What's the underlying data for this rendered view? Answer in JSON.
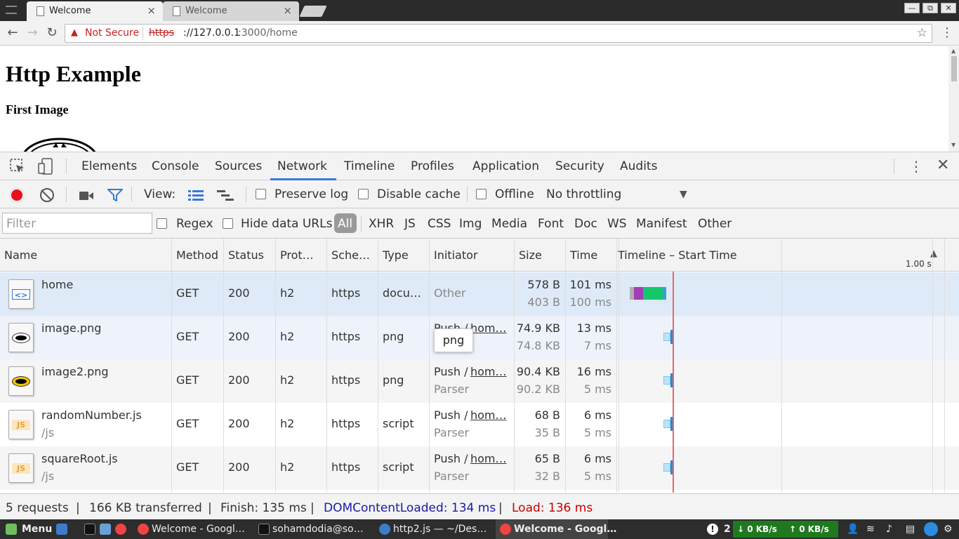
{
  "browser": {
    "tabs": [
      {
        "label": "Welcome",
        "active": true
      },
      {
        "label": "Welcome",
        "active": false
      }
    ],
    "tab_close": "×",
    "window_buttons": [
      "—",
      "⧉",
      "✕"
    ],
    "omnibox": {
      "security_label": "Not Secure",
      "scheme": "https",
      "host": "://127.0.0.1",
      "path": ":3000/home"
    }
  },
  "page": {
    "heading": "Http Example",
    "subheading": "First Image"
  },
  "devtools": {
    "tabs": [
      "Elements",
      "Console",
      "Sources",
      "Network",
      "Timeline",
      "Profiles",
      "Application",
      "Security",
      "Audits"
    ],
    "active_tab": "Network",
    "controls": {
      "view_label": "View:",
      "preserve_log": "Preserve log",
      "disable_cache": "Disable cache",
      "offline": "Offline",
      "throttling": "No throttling"
    },
    "filters": {
      "placeholder": "Filter",
      "regex": "Regex",
      "hide_data_urls": "Hide data URLs",
      "types": [
        "All",
        "XHR",
        "JS",
        "CSS",
        "Img",
        "Media",
        "Font",
        "Doc",
        "WS",
        "Manifest",
        "Other"
      ],
      "active_type": "All"
    },
    "columns": [
      "Name",
      "Method",
      "Status",
      "Prot…",
      "Sche…",
      "Type",
      "Initiator",
      "Size",
      "Time",
      "Timeline – Start Time"
    ],
    "timeline_scale": "1.00 s",
    "rows": [
      {
        "name": "home",
        "path": "",
        "method": "GET",
        "status": "200",
        "protocol": "h2",
        "scheme": "https",
        "type": "docu…",
        "initiator": "Other",
        "initiator_link": "",
        "initiator_sub": "",
        "size": "578 B",
        "size_sub": "403 B",
        "time": "101 ms",
        "time_sub": "100 ms",
        "icon": "document-icon",
        "bg": "#dfeaf8"
      },
      {
        "name": "image.png",
        "path": "",
        "method": "GET",
        "status": "200",
        "protocol": "h2",
        "scheme": "https",
        "type": "png",
        "initiator": "Push / ",
        "initiator_link": "hom…",
        "initiator_sub": "",
        "size": "74.9 KB",
        "size_sub": "74.8 KB",
        "time": "13 ms",
        "time_sub": "7 ms",
        "icon": "image-icon",
        "bg": "#eef3fb"
      },
      {
        "name": "image2.png",
        "path": "",
        "method": "GET",
        "status": "200",
        "protocol": "h2",
        "scheme": "https",
        "type": "png",
        "initiator": "Push / ",
        "initiator_link": "hom…",
        "initiator_sub": "Parser",
        "size": "90.4 KB",
        "size_sub": "90.2 KB",
        "time": "16 ms",
        "time_sub": "5 ms",
        "icon": "image-icon",
        "bg": "#f5f5f5"
      },
      {
        "name": "randomNumber.js",
        "path": "/js",
        "method": "GET",
        "status": "200",
        "protocol": "h2",
        "scheme": "https",
        "type": "script",
        "initiator": "Push / ",
        "initiator_link": "hom…",
        "initiator_sub": "Parser",
        "size": "68 B",
        "size_sub": "35 B",
        "time": "6 ms",
        "time_sub": "5 ms",
        "icon": "js-file-icon",
        "bg": "#ffffff"
      },
      {
        "name": "squareRoot.js",
        "path": "/js",
        "method": "GET",
        "status": "200",
        "protocol": "h2",
        "scheme": "https",
        "type": "script",
        "initiator": "Push / ",
        "initiator_link": "hom…",
        "initiator_sub": "Parser",
        "size": "65 B",
        "size_sub": "32 B",
        "time": "6 ms",
        "time_sub": "5 ms",
        "icon": "js-file-icon",
        "bg": "#f5f5f5"
      }
    ],
    "tooltip": "png",
    "status": {
      "requests": "5 requests",
      "transferred": "166 KB transferred",
      "finish": "Finish: 135 ms",
      "dom_content_loaded": "DOMContentLoaded: 134 ms",
      "load": "Load: 136 ms",
      "separator": "|"
    },
    "colors": {
      "dcl": "#1a1aa6",
      "load": "#c80000",
      "record": "#e8111b",
      "accent": "#3879d9"
    }
  },
  "taskbar": {
    "menu": "Menu",
    "items": [
      "Welcome - Googl…",
      "sohamdodia@so…",
      "http2.js — ~/Des…",
      "Welcome - Googl…"
    ],
    "notif_count": "2",
    "net_down": "↓ 0 KB/s",
    "net_up": "↑ 0 KB/s"
  }
}
